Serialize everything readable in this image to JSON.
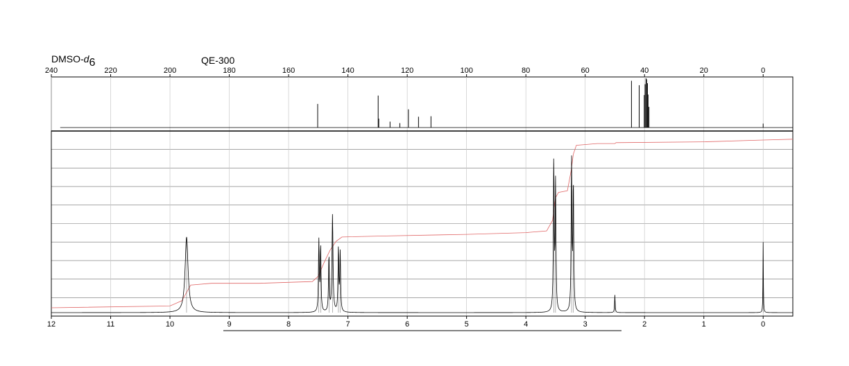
{
  "header": {
    "solvent_prefix": "DMSO-",
    "solvent_italic": "d",
    "solvent_subscript": "6",
    "instrument": "QE-300"
  },
  "chart_data": [
    {
      "type": "line",
      "nucleus": "13C",
      "x_unit": "ppm",
      "xlim": [
        240,
        -10
      ],
      "x_reversed": true,
      "tick_labels": [
        "240",
        "220",
        "200",
        "180",
        "160",
        "140",
        "120",
        "100",
        "80",
        "60",
        "40",
        "20",
        "0"
      ],
      "tick_values": [
        240,
        220,
        200,
        180,
        160,
        140,
        120,
        100,
        80,
        60,
        40,
        20,
        0
      ],
      "grid": true,
      "peaks": [
        {
          "x": 150.2,
          "height": 0.48
        },
        {
          "x": 129.8,
          "height": 0.65
        },
        {
          "x": 129.6,
          "height": 0.18
        },
        {
          "x": 125.8,
          "height": 0.12
        },
        {
          "x": 122.5,
          "height": 0.09
        },
        {
          "x": 119.6,
          "height": 0.37
        },
        {
          "x": 116.2,
          "height": 0.22
        },
        {
          "x": 112.0,
          "height": 0.23
        },
        {
          "x": 44.4,
          "height": 0.95
        },
        {
          "x": 41.8,
          "height": 0.86
        },
        {
          "x": 40.1,
          "height": 0.66
        },
        {
          "x": 39.8,
          "height": 0.88
        },
        {
          "x": 39.5,
          "height": 1.0
        },
        {
          "x": 39.3,
          "height": 0.98
        },
        {
          "x": 39.0,
          "height": 0.9
        },
        {
          "x": 38.8,
          "height": 0.67
        },
        {
          "x": 38.5,
          "height": 0.42
        },
        {
          "x": 0.0,
          "height": 0.08
        }
      ],
      "baseline_range": [
        237,
        -10
      ]
    },
    {
      "type": "line",
      "nucleus": "1H",
      "x_unit": "ppm",
      "xlim": [
        12,
        -0.5
      ],
      "x_reversed": true,
      "tick_labels": [
        "12",
        "11",
        "10",
        "9",
        "8",
        "7",
        "6",
        "5",
        "4",
        "3",
        "2",
        "1",
        "0"
      ],
      "tick_values": [
        12,
        11,
        10,
        9,
        8,
        7,
        6,
        5,
        4,
        3,
        2,
        1,
        0
      ],
      "grid": true,
      "peaks": [
        {
          "x": 9.72,
          "height": 0.43,
          "width": 0.03
        },
        {
          "x": 7.49,
          "height": 0.4,
          "width": 0.008
        },
        {
          "x": 7.46,
          "height": 0.37,
          "width": 0.008
        },
        {
          "x": 7.32,
          "height": 0.32,
          "width": 0.008
        },
        {
          "x": 7.26,
          "height": 0.55,
          "width": 0.01
        },
        {
          "x": 7.16,
          "height": 0.36,
          "width": 0.008
        },
        {
          "x": 7.13,
          "height": 0.33,
          "width": 0.008
        },
        {
          "x": 3.53,
          "height": 0.85,
          "width": 0.008
        },
        {
          "x": 3.5,
          "height": 0.72,
          "width": 0.008
        },
        {
          "x": 3.23,
          "height": 0.85,
          "width": 0.008
        },
        {
          "x": 3.2,
          "height": 0.72,
          "width": 0.008
        },
        {
          "x": 2.5,
          "height": 0.1,
          "width": 0.006
        },
        {
          "x": 0.0,
          "height": 0.4,
          "width": 0.004
        }
      ],
      "integral_curve": [
        [
          12.0,
          0.02
        ],
        [
          10.0,
          0.03
        ],
        [
          9.8,
          0.06
        ],
        [
          9.65,
          0.15
        ],
        [
          9.3,
          0.16
        ],
        [
          8.5,
          0.16
        ],
        [
          7.6,
          0.17
        ],
        [
          7.5,
          0.2
        ],
        [
          7.4,
          0.28
        ],
        [
          7.3,
          0.35
        ],
        [
          7.2,
          0.4
        ],
        [
          7.1,
          0.425
        ],
        [
          6.5,
          0.43
        ],
        [
          5.0,
          0.44
        ],
        [
          4.0,
          0.45
        ],
        [
          3.65,
          0.46
        ],
        [
          3.55,
          0.52
        ],
        [
          3.5,
          0.65
        ],
        [
          3.45,
          0.68
        ],
        [
          3.3,
          0.69
        ],
        [
          3.24,
          0.8
        ],
        [
          3.2,
          0.9
        ],
        [
          3.15,
          0.95
        ],
        [
          2.8,
          0.96
        ],
        [
          2.5,
          0.96
        ],
        [
          2.48,
          0.965
        ],
        [
          1.0,
          0.97
        ],
        [
          0.0,
          0.98
        ],
        [
          -0.5,
          0.985
        ]
      ]
    }
  ]
}
